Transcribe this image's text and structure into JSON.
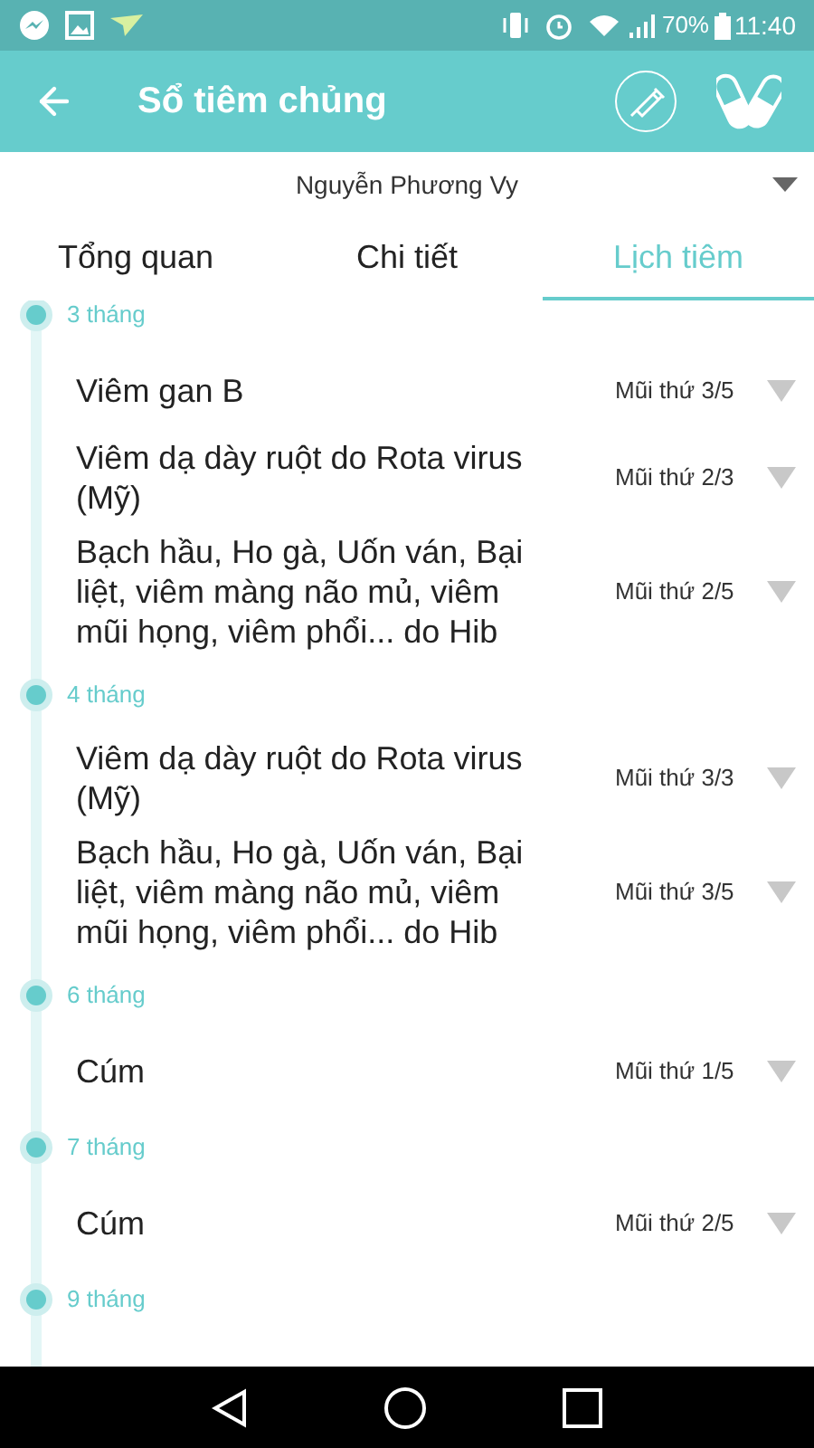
{
  "status_bar": {
    "battery": "70%",
    "time": "11:40"
  },
  "app_bar": {
    "title": "Sổ tiêm chủng"
  },
  "profile": {
    "name": "Nguyễn Phương Vy"
  },
  "tabs": [
    {
      "label": "Tổng quan",
      "selected": false
    },
    {
      "label": "Chi tiết",
      "selected": false
    },
    {
      "label": "Lịch tiêm",
      "selected": true
    }
  ],
  "schedule": [
    {
      "age": "3 tháng",
      "vaccines": [
        {
          "name": "Viêm gan B",
          "dose": "Mũi thứ 3/5"
        },
        {
          "name": "Viêm dạ dày ruột do Rota virus (Mỹ)",
          "dose": "Mũi thứ 2/3"
        },
        {
          "name": "Bạch hầu, Ho gà, Uốn ván, Bại liệt, viêm màng não mủ, viêm mũi họng, viêm phổi... do Hib",
          "dose": "Mũi thứ 2/5"
        }
      ]
    },
    {
      "age": "4 tháng",
      "vaccines": [
        {
          "name": "Viêm dạ dày ruột do Rota virus (Mỹ)",
          "dose": "Mũi thứ 3/3"
        },
        {
          "name": "Bạch hầu, Ho gà, Uốn ván, Bại liệt, viêm màng não mủ, viêm mũi họng, viêm phổi... do Hib",
          "dose": "Mũi thứ 3/5"
        }
      ]
    },
    {
      "age": "6 tháng",
      "vaccines": [
        {
          "name": "Cúm",
          "dose": "Mũi thứ 1/5"
        }
      ]
    },
    {
      "age": "7 tháng",
      "vaccines": [
        {
          "name": "Cúm",
          "dose": "Mũi thứ 2/5"
        }
      ]
    },
    {
      "age": "9 tháng"
    }
  ]
}
